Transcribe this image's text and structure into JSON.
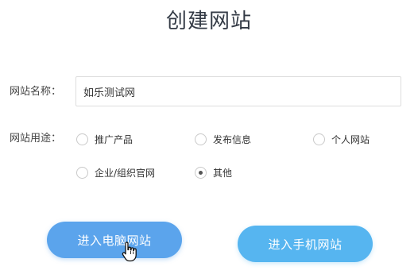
{
  "page": {
    "title": "创建网站"
  },
  "form": {
    "name_label": "网站名称：",
    "name_value": "如乐测试网",
    "purpose_label": "网站用途：",
    "purpose_options": [
      {
        "label": "推广产品",
        "selected": false
      },
      {
        "label": "发布信息",
        "selected": false
      },
      {
        "label": "个人网站",
        "selected": false
      },
      {
        "label": "企业/组织官网",
        "selected": false
      },
      {
        "label": "其他",
        "selected": true
      }
    ]
  },
  "buttons": {
    "pc_label": "进入电脑网站",
    "mobile_label": "进入手机网站"
  },
  "colors": {
    "pc_button": "#5ba4ec",
    "mobile_button": "#56b5f0"
  },
  "icons": {
    "cursor": "hand-pointer-icon"
  }
}
